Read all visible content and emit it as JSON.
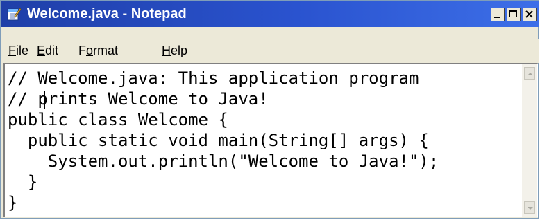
{
  "window": {
    "title": "Welcome.java - Notepad",
    "icon": "notepad-icon",
    "buttons": {
      "minimize": "minimize-icon",
      "maximize": "maximize-icon",
      "close": "close-icon"
    }
  },
  "menu": {
    "file": {
      "accel": "F",
      "rest": "ile"
    },
    "edit": {
      "accel": "E",
      "rest": "dit"
    },
    "format": {
      "pre": "F",
      "accel": "o",
      "rest": "rmat"
    },
    "help": {
      "accel": "H",
      "rest": "elp"
    }
  },
  "editor": {
    "lines": [
      "// Welcome.java: This application program",
      "// prints Welcome to Java!",
      "public class Welcome {",
      "  public static void main(String[] args) {",
      "    System.out.println(\"Welcome to Java!\");",
      "  }",
      "}"
    ]
  },
  "colors": {
    "titlebar": "#2a53cf",
    "chrome": "#ece9d8",
    "editor_bg": "#ffffff",
    "text": "#000000"
  }
}
